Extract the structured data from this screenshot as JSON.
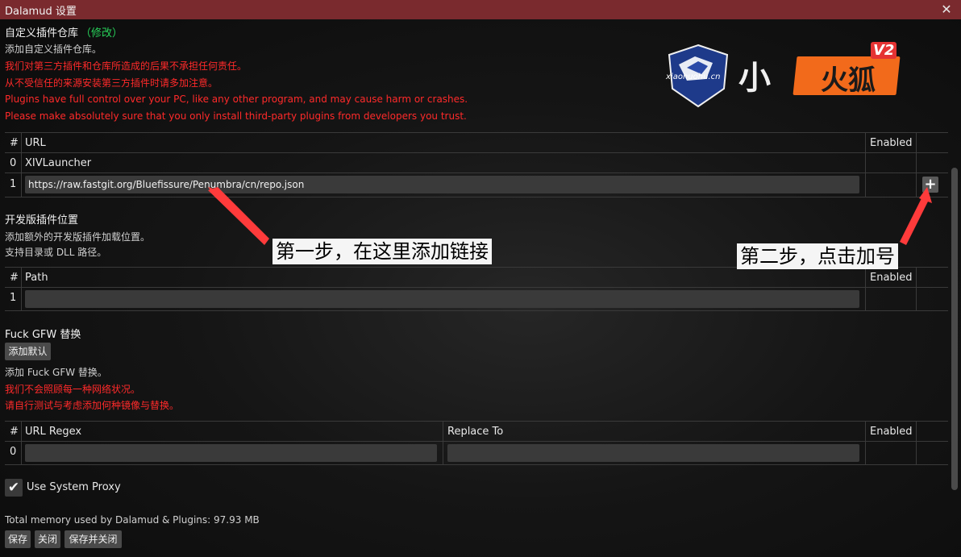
{
  "window": {
    "title": "Dalamud 设置"
  },
  "repo_section": {
    "title": "自定义插件仓库",
    "edit_label": "（修改）",
    "desc": "添加自定义插件仓库。",
    "warnings": [
      "我们对第三方插件和仓库所造成的后果不承担任何责任。",
      "从不受信任的来源安装第三方插件时请多加注意。",
      "Plugins have full control over your PC, like any other program, and may cause harm or crashes.",
      "Please make absolutely sure that you only install third-party plugins from developers you trust."
    ],
    "table_headers": {
      "num": "#",
      "url": "URL",
      "enabled": "Enabled"
    },
    "rows": [
      {
        "num": "0",
        "url": "XIVLauncher"
      }
    ],
    "new_row_num": "1",
    "new_url_value": "https://raw.fastgit.org/Bluefissure/Penumbra/cn/repo.json",
    "add_button": "+"
  },
  "dev_section": {
    "title": "开发版插件位置",
    "desc1": "添加额外的开发版插件加载位置。",
    "desc2": "支持目录或 DLL 路径。",
    "table_headers": {
      "num": "#",
      "path": "Path",
      "enabled": "Enabled"
    },
    "new_row_num": "1",
    "new_path_value": ""
  },
  "gfw_section": {
    "title": "Fuck GFW 替换",
    "add_default_button": "添加默认",
    "desc": "添加 Fuck GFW 替换。",
    "warnings": [
      "我们不会照顾每一种网络状况。",
      "请自行测试与考虑添加何种镜像与替换。"
    ],
    "table_headers": {
      "num": "#",
      "regex": "URL Regex",
      "replace": "Replace To",
      "enabled": "Enabled"
    },
    "new_row_num": "0"
  },
  "proxy": {
    "label": "Use System Proxy",
    "checked": true
  },
  "memory_text": "Total memory used by Dalamud & Plugins: 97.93 MB",
  "buttons": {
    "save": "保存",
    "close": "关闭",
    "save_close": "保存并关闭"
  },
  "annotations": {
    "step1": "第一步，在这里添加链接",
    "step2": "第二步，点击加号"
  },
  "logo": {
    "mascot_text": "xiaohuohu.cn",
    "char": "小",
    "name": "火狐",
    "version": "V2"
  },
  "colors": {
    "titlebar": "#7a2a2e",
    "warning": "#ff2a2a",
    "edit": "#28d15a",
    "logo_orange": "#f26a1b"
  }
}
